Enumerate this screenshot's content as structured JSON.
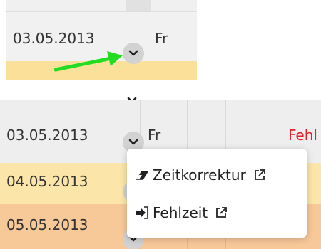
{
  "top_view": {
    "date": "03.05.2013",
    "day": "Fr"
  },
  "bottom_view": {
    "rows": [
      {
        "date": "03.05.2013",
        "day": "Fr",
        "status": "Fehl"
      },
      {
        "date": "04.05.2013"
      },
      {
        "date": "05.05.2013"
      }
    ],
    "menu": {
      "items": [
        {
          "label": "Zeitkorrektur",
          "icon": "eraser-icon",
          "trailing_icon": "external-link-icon"
        },
        {
          "label": "Fehlzeit",
          "icon": "sign-in-icon",
          "trailing_icon": "external-link-icon"
        }
      ]
    }
  },
  "colors": {
    "row_gray": "#eeeeee",
    "row_yellow": "#fbe5a8",
    "row_orange": "#f7c898",
    "status_red": "#e5202a",
    "arrow_green": "#22dd22",
    "dropdown_button": "#d2d2d2"
  }
}
